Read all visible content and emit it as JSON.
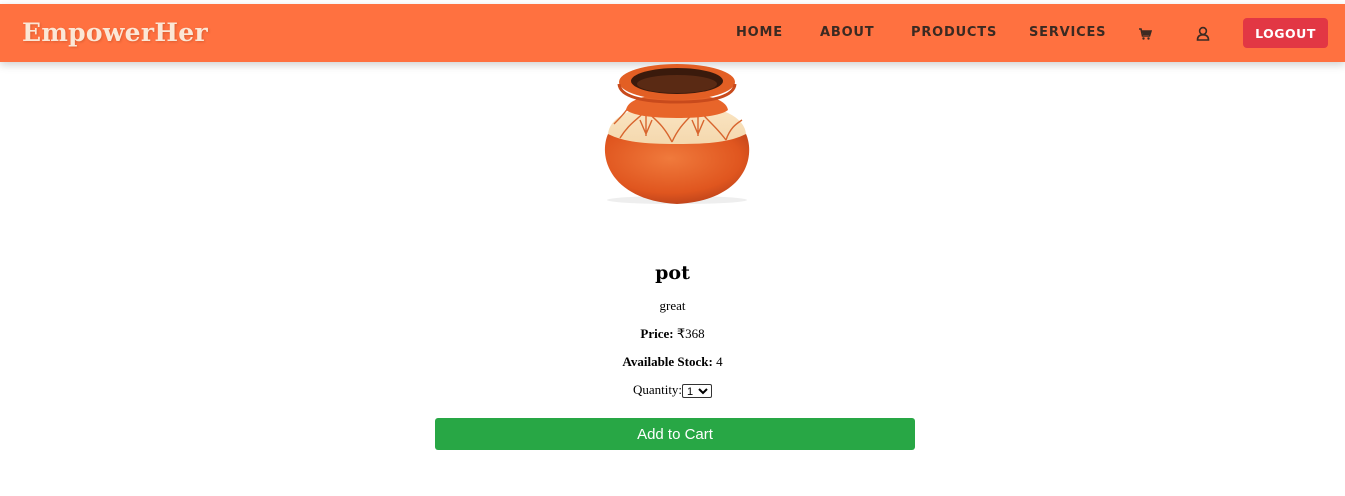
{
  "brand": "EmpowerHer",
  "nav": {
    "home": "HOME",
    "about": "ABOUT",
    "products": "PRODUCTS",
    "services": "SERVICES",
    "logout": "LOGOUT"
  },
  "icons": {
    "cart": "cart-icon",
    "user": "user-icon"
  },
  "colors": {
    "navbar": "#ff7140",
    "logout": "#e23744",
    "add_to_cart": "#28a745"
  },
  "product": {
    "name": "pot",
    "description": "great",
    "price_label": "Price:",
    "price_value": "₹368",
    "stock_label": "Available Stock:",
    "stock_value": "4",
    "quantity_label": "Quantity:",
    "quantity_selected": "1"
  },
  "actions": {
    "add_to_cart": "Add to Cart"
  }
}
